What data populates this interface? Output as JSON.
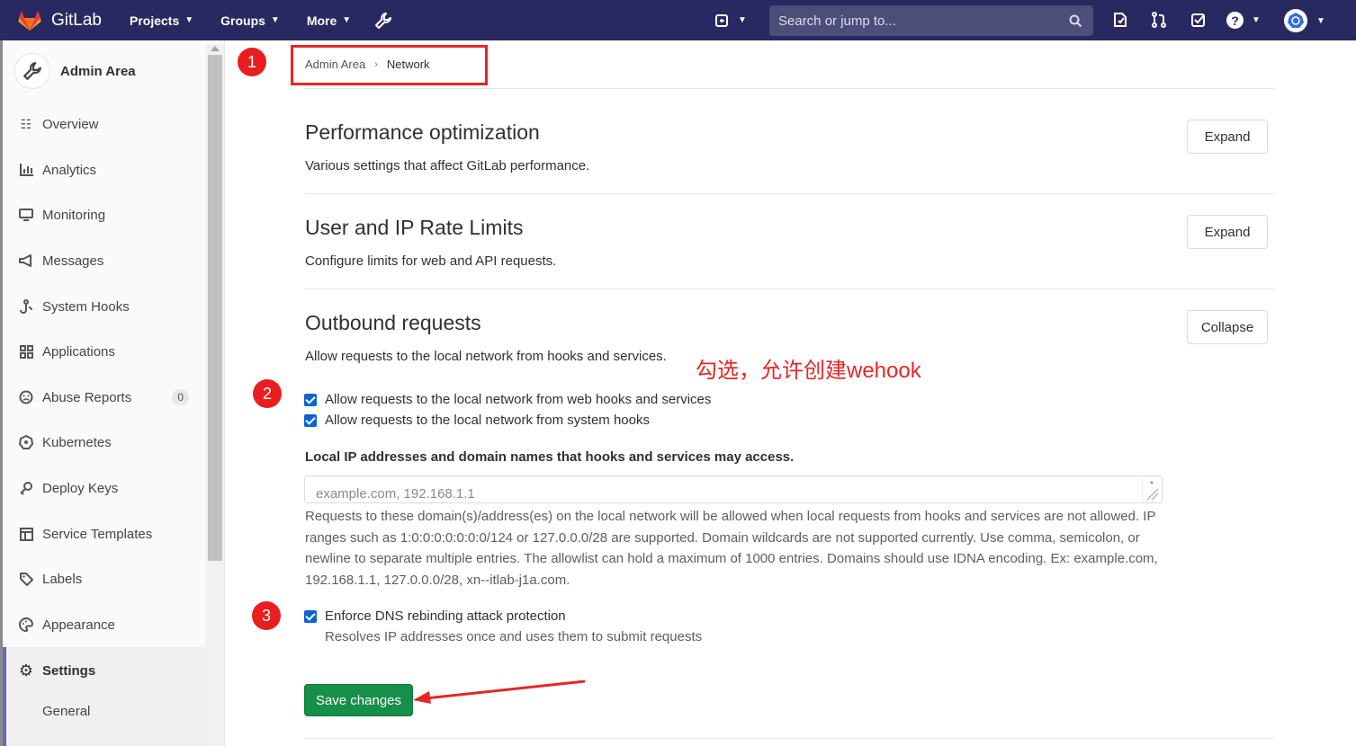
{
  "topbar": {
    "brand": "GitLab",
    "nav": [
      {
        "label": "Projects"
      },
      {
        "label": "Groups"
      },
      {
        "label": "More"
      }
    ],
    "search_placeholder": "Search or jump to..."
  },
  "sidebar": {
    "title": "Admin Area",
    "items": [
      {
        "label": "Overview",
        "icon": "overview-icon"
      },
      {
        "label": "Analytics",
        "icon": "chart-icon"
      },
      {
        "label": "Monitoring",
        "icon": "monitor-icon"
      },
      {
        "label": "Messages",
        "icon": "megaphone-icon"
      },
      {
        "label": "System Hooks",
        "icon": "hook-icon"
      },
      {
        "label": "Applications",
        "icon": "apps-icon"
      },
      {
        "label": "Abuse Reports",
        "icon": "frown-icon",
        "badge": "0"
      },
      {
        "label": "Kubernetes",
        "icon": "kubernetes-icon"
      },
      {
        "label": "Deploy Keys",
        "icon": "key-icon"
      },
      {
        "label": "Service Templates",
        "icon": "template-icon"
      },
      {
        "label": "Labels",
        "icon": "label-icon"
      },
      {
        "label": "Appearance",
        "icon": "palette-icon"
      },
      {
        "label": "Settings",
        "icon": "gear-icon",
        "active": true
      },
      {
        "label": "General"
      }
    ]
  },
  "breadcrumb": {
    "parent": "Admin Area",
    "current": "Network"
  },
  "sections": [
    {
      "title": "Performance optimization",
      "desc": "Various settings that affect GitLab performance.",
      "button": "Expand"
    },
    {
      "title": "User and IP Rate Limits",
      "desc": "Configure limits for web and API requests.",
      "button": "Expand"
    },
    {
      "title": "Outbound requests",
      "desc": "Allow requests to the local network from hooks and services.",
      "button": "Collapse"
    }
  ],
  "outbound": {
    "checkbox_webhooks": "Allow requests to the local network from web hooks and services",
    "checkbox_system_hooks": "Allow requests to the local network from system hooks",
    "allowlist_label": "Local IP addresses and domain names that hooks and services may access.",
    "allowlist_placeholder": "example.com, 192.168.1.1",
    "help_text": "Requests to these domain(s)/address(es) on the local network will be allowed when local requests from hooks and services are not allowed. IP ranges such as 1:0:0:0:0:0:0:0/124 or 127.0.0.0/28 are supported. Domain wildcards are not supported currently. Use comma, semicolon, or newline to separate multiple entries. The allowlist can hold a maximum of 1000 entries. Domains should use IDNA encoding. Ex: example.com, 192.168.1.1, 127.0.0.0/28, xn--itlab-j1a.com.",
    "checkbox_dns": "Enforce DNS rebinding attack protection",
    "dns_desc": "Resolves IP addresses once and uses them to submit requests",
    "save_label": "Save changes"
  },
  "annotations": {
    "markers": [
      "1",
      "2",
      "3"
    ],
    "note": "勾选，允许创建wehook",
    "color": "#e62626"
  },
  "colors": {
    "topbar": "#292961",
    "save": "#168f48",
    "checkbox": "#0b63d4"
  }
}
